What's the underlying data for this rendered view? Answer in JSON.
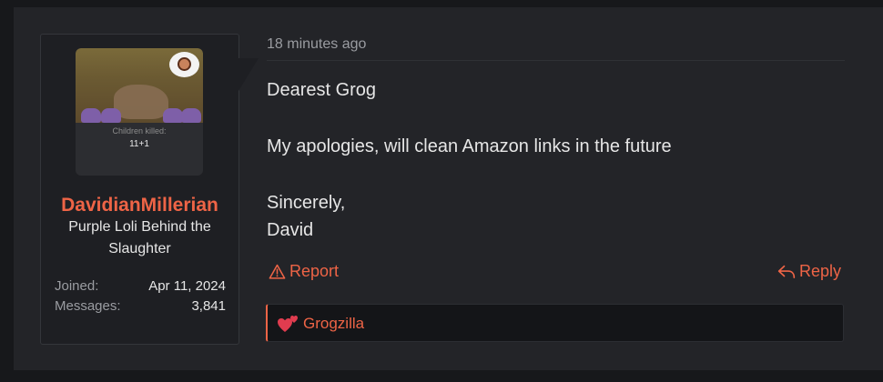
{
  "post": {
    "time": "18 minutes ago",
    "message": {
      "greeting": "Dearest Grog",
      "body": "My apologies, will clean Amazon links in the future",
      "closing": "Sincerely,",
      "signature": "David"
    },
    "actions": {
      "report_label": "Report",
      "reply_label": "Reply"
    },
    "reactions": {
      "user": "Grogzilla",
      "icon": "hearts-icon"
    }
  },
  "user": {
    "avatar_caption": "Children killed:",
    "avatar_count": "11+1",
    "name": "DavidianMillerian",
    "title": "Purple Loli Behind the Slaughter",
    "stats": [
      {
        "key": "Joined:",
        "value": "Apr 11, 2024"
      },
      {
        "key": "Messages:",
        "value": "3,841"
      }
    ]
  },
  "colors": {
    "accent": "#ee6446",
    "background": "#17181b",
    "panel": "#232428"
  }
}
